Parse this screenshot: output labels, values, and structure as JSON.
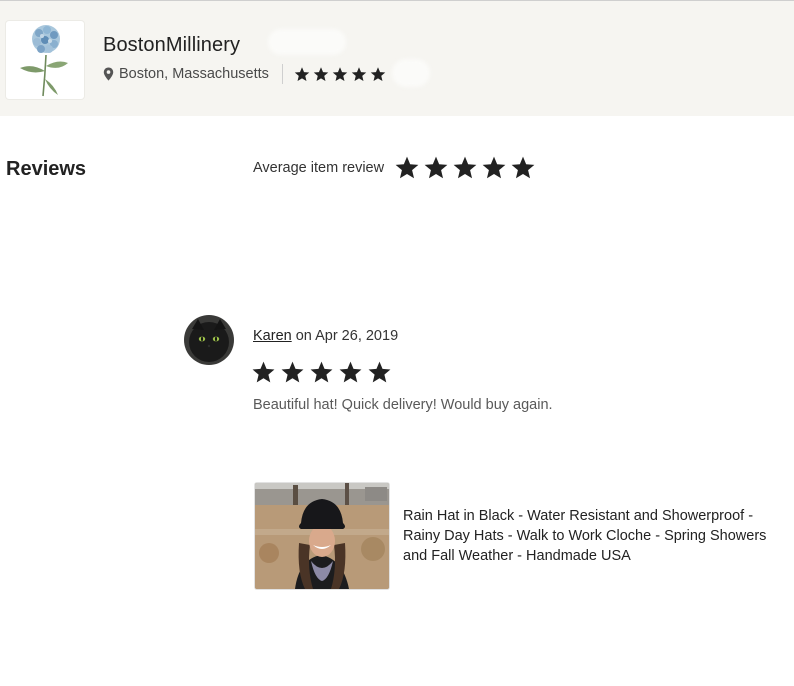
{
  "shop": {
    "name": "BostonMillinery",
    "location": "Boston, Massachusetts",
    "rating_stars": 5
  },
  "reviews_section": {
    "title": "Reviews",
    "average_label": "Average item review",
    "average_stars": 5
  },
  "review": {
    "reviewer": "Karen",
    "date_prefix": " on ",
    "date": "Apr 26, 2019",
    "stars": 5,
    "text": "Beautiful hat! Quick delivery! Would buy again."
  },
  "product": {
    "title": "Rain Hat in Black - Water Resistant and Showerproof - Rainy Day Hats - Walk to Work Cloche - Spring Showers and Fall Weather - Handmade USA"
  },
  "icons": {
    "location": "map-pin-icon",
    "star": "star-icon"
  },
  "colors": {
    "header_bg": "#f6f5f1",
    "star": "#222222",
    "text_muted": "#595959"
  }
}
